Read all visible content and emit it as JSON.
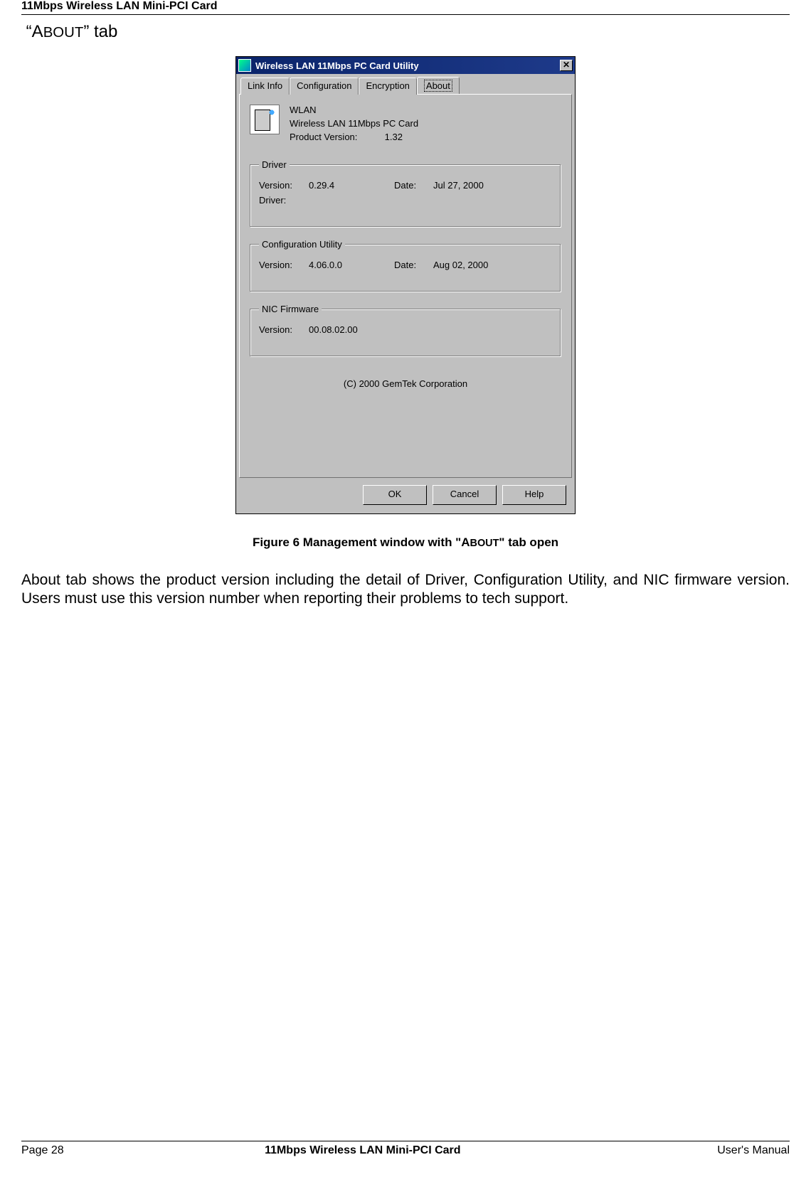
{
  "header": {
    "product": "11Mbps Wireless LAN Mini-PCI Card"
  },
  "section_title": {
    "quote_open": "“",
    "a": "A",
    "bout": "BOUT",
    "rest": "” tab"
  },
  "dialog": {
    "title": "Wireless LAN 11Mbps PC Card Utility",
    "close_x": "✕",
    "tabs": {
      "link": "Link Info",
      "config": "Configuration",
      "encryption": "Encryption",
      "about": "About"
    },
    "info": {
      "name": "WLAN",
      "desc": "Wireless LAN 11Mbps PC Card",
      "pv_label": "Product Version:",
      "pv_value": "1.32"
    },
    "driver": {
      "legend": "Driver",
      "ver_label": "Version:",
      "ver_value": "0.29.4",
      "date_label": "Date:",
      "date_value": "Jul 27, 2000",
      "driver_label": "Driver:",
      "driver_value": ""
    },
    "cfgutil": {
      "legend": "Configuration Utility",
      "ver_label": "Version:",
      "ver_value": "4.06.0.0",
      "date_label": "Date:",
      "date_value": "Aug 02, 2000"
    },
    "nic": {
      "legend": "NIC Firmware",
      "ver_label": "Version:",
      "ver_value": "00.08.02.00"
    },
    "copyright": "(C) 2000 GemTek Corporation",
    "buttons": {
      "ok": "OK",
      "cancel": "Cancel",
      "help": "Help"
    }
  },
  "figure": {
    "pre": "Figure 6 Management window with \"A",
    "sc": "BOUT",
    "post": "\" tab open"
  },
  "body": "About tab shows the product version including the detail of Driver, Configuration Utility, and NIC firmware version. Users must use this version number when reporting their problems to tech support.",
  "footer": {
    "page": "Page 28",
    "center": "11Mbps Wireless LAN Mini-PCI Card",
    "right": "User's Manual"
  }
}
